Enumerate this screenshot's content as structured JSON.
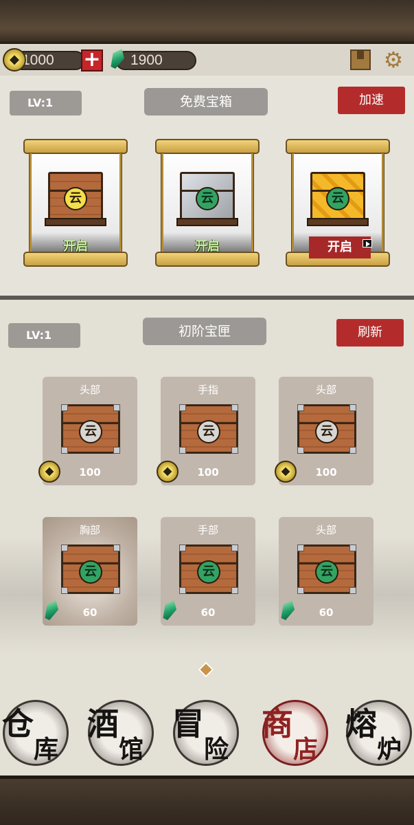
{
  "currency": {
    "coins": "1000",
    "gems": "1900",
    "add_label": "+"
  },
  "top_icons": [
    "box-icon",
    "gear-icon"
  ],
  "free_chest_panel": {
    "level": "LV:1",
    "title": "免费宝箱",
    "speed_button": "加速",
    "chests": [
      {
        "type": "wood",
        "open_label": "开启",
        "ad": false
      },
      {
        "type": "silver",
        "open_label": "开启",
        "ad": false
      },
      {
        "type": "gold",
        "open_label": "开启",
        "ad": true
      }
    ]
  },
  "shop_panel": {
    "level": "LV:1",
    "title": "初阶宝匣",
    "refresh_button": "刷新",
    "items": [
      {
        "slot": "头部",
        "price": "100",
        "currency": "coin"
      },
      {
        "slot": "手指",
        "price": "100",
        "currency": "coin"
      },
      {
        "slot": "头部",
        "price": "100",
        "currency": "coin"
      },
      {
        "slot": "胸部",
        "price": "60",
        "currency": "gem"
      },
      {
        "slot": "手部",
        "price": "60",
        "currency": "gem"
      },
      {
        "slot": "头部",
        "price": "60",
        "currency": "gem"
      }
    ]
  },
  "nav": [
    {
      "c1": "仓",
      "c2": "库",
      "active": false
    },
    {
      "c1": "酒",
      "c2": "馆",
      "active": false
    },
    {
      "c1": "冒",
      "c2": "险",
      "active": false
    },
    {
      "c1": "商",
      "c2": "店",
      "active": true
    },
    {
      "c1": "熔",
      "c2": "炉",
      "active": false
    }
  ],
  "colors": {
    "accent_red": "#b32c2b",
    "gold": "#f3df4b",
    "gem_green": "#1f9f69"
  }
}
